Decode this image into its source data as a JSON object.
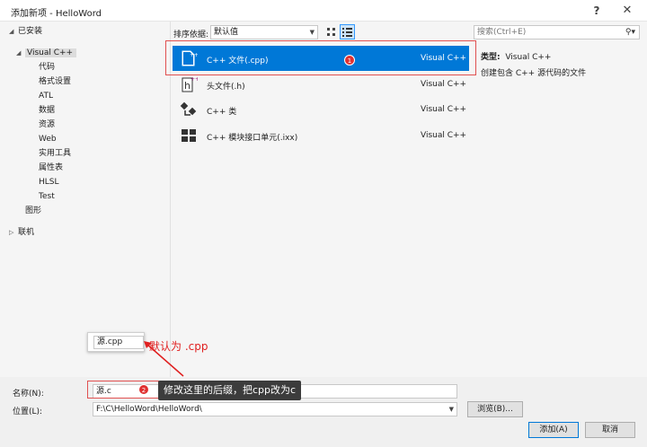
{
  "window": {
    "title": "添加新项 - HelloWord",
    "help_label": "?",
    "close_label": "✕"
  },
  "tree": {
    "installed": "已安装",
    "visual_cpp": "Visual C++",
    "children": [
      "代码",
      "格式设置",
      "ATL",
      "数据",
      "资源",
      "Web",
      "实用工具",
      "属性表",
      "HLSL",
      "Test"
    ],
    "graphics": "图形",
    "online": "联机"
  },
  "toolbar": {
    "sort_label": "排序依据:",
    "sort_value": "默认值"
  },
  "templates": [
    {
      "name": "C++ 文件(.cpp)",
      "lang": "Visual C++"
    },
    {
      "name": "头文件(.h)",
      "lang": "Visual C++"
    },
    {
      "name": "C++ 类",
      "lang": "Visual C++"
    },
    {
      "name": "C++ 模块接口单元(.ixx)",
      "lang": "Visual C++"
    }
  ],
  "details": {
    "search_placeholder": "搜索(Ctrl+E)",
    "type_label": "类型:",
    "type_value": "Visual C++",
    "description": "创建包含 C++ 源代码的文件"
  },
  "form": {
    "name_label": "名称(N):",
    "name_value": "源.c",
    "location_label": "位置(L):",
    "location_value": "F:\\C\\HelloWord\\HelloWord\\",
    "browse_label": "浏览(B)...",
    "add_label": "添加(A)",
    "cancel_label": "取消"
  },
  "annotations": {
    "badge1": "1",
    "badge2": "2",
    "default_value": "源.cpp",
    "default_note": "默认为  .cpp",
    "tip": "修改这里的后缀，把cpp改为c"
  },
  "colors": {
    "selection": "#0078d7",
    "annotation_red": "#e02020"
  }
}
